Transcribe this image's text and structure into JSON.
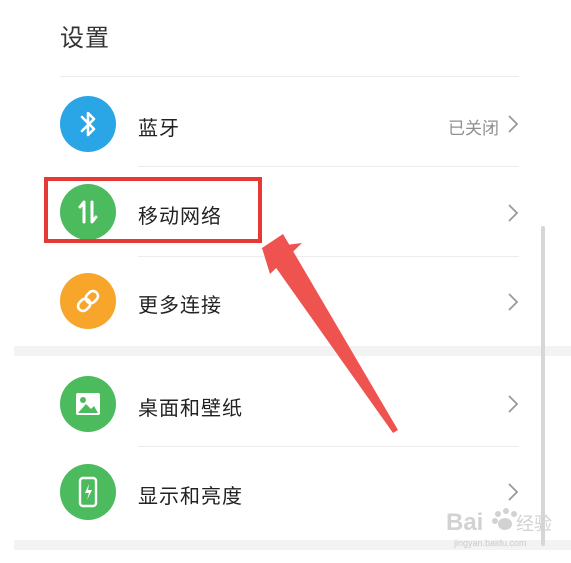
{
  "page": {
    "title": "设置"
  },
  "rows": [
    {
      "label": "蓝牙",
      "value": "已关闭",
      "icon": "bluetooth-icon",
      "color": "#2aa5e6"
    },
    {
      "label": "移动网络",
      "value": "",
      "icon": "mobile-network-icon",
      "color": "#4cbb5e"
    },
    {
      "label": "更多连接",
      "value": "",
      "icon": "link-icon",
      "color": "#f7a52b"
    },
    {
      "label": "桌面和壁纸",
      "value": "",
      "icon": "wallpaper-icon",
      "color": "#4cbb5e"
    },
    {
      "label": "显示和亮度",
      "value": "",
      "icon": "display-brightness-icon",
      "color": "#4cbb5e"
    }
  ],
  "annotation": {
    "highlight_color": "#e53935",
    "arrow_color": "#ef5350",
    "highlighted_item": "移动网络"
  },
  "watermark": {
    "brand": "Baidu",
    "brand_cn": "经验",
    "url": "jingyan.baidu.com"
  }
}
